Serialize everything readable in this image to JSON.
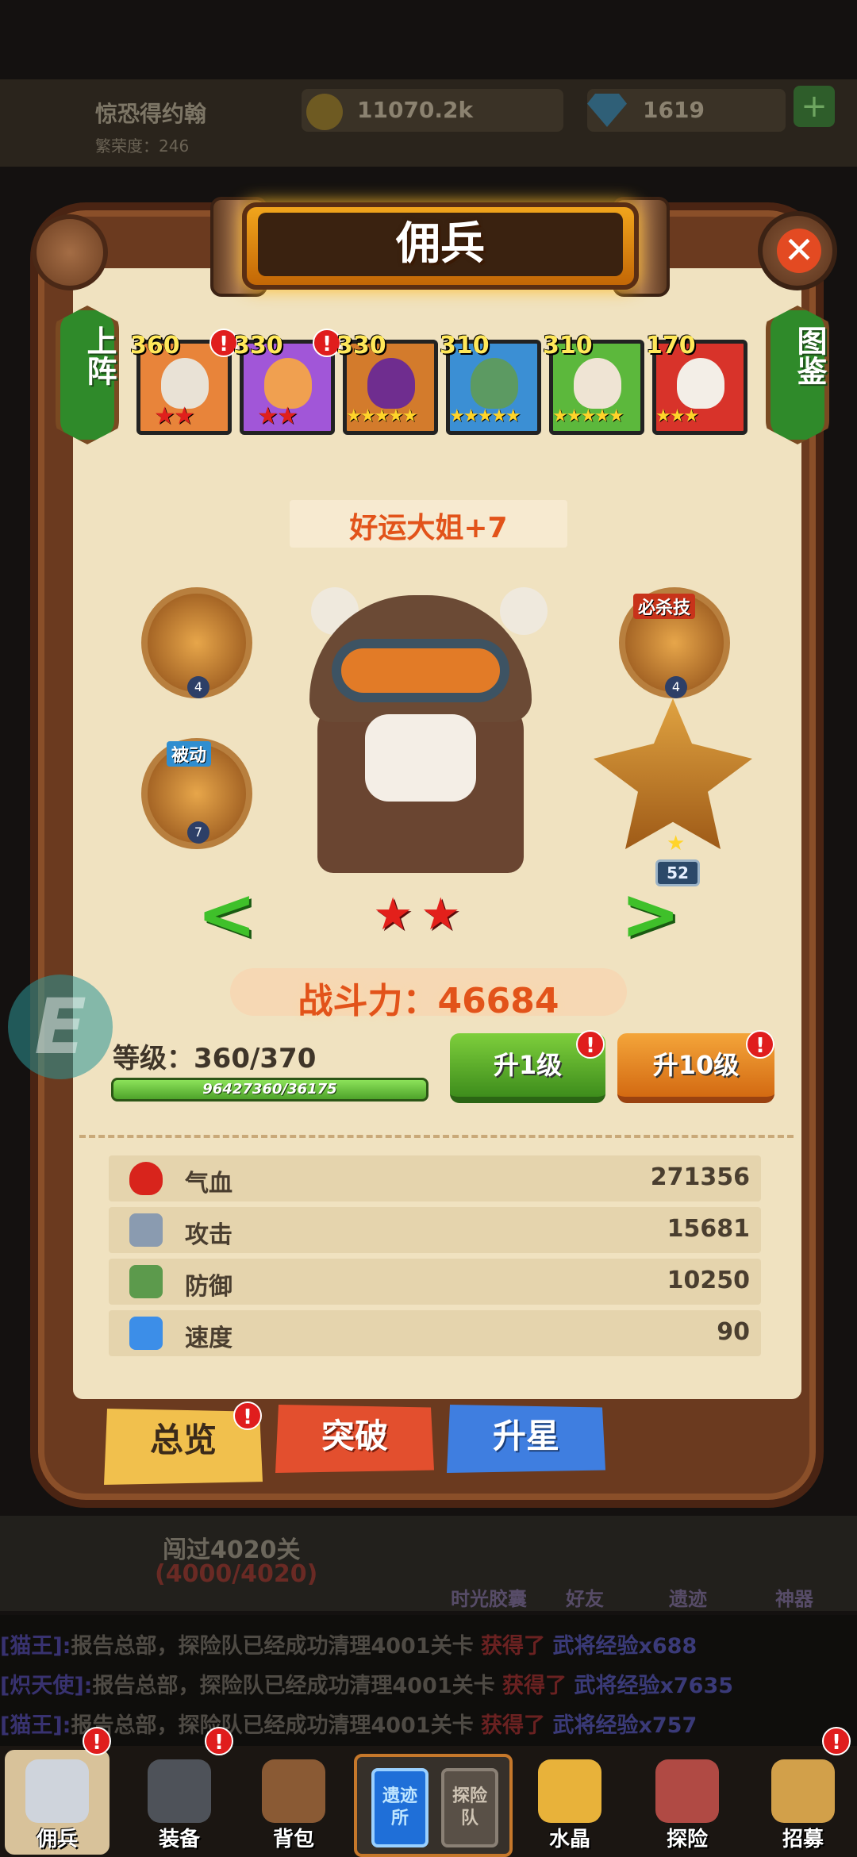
{
  "background": {
    "player_name": "惊恐得约翰",
    "reputation": "繁荣度：246",
    "coins": "11070.2k",
    "gems": "1619",
    "stage_title": "闯过4020关",
    "stage_progress": "(4000/4020)",
    "feature_labels": [
      "时光胶囊",
      "好友",
      "遗迹",
      "神器"
    ],
    "chat": [
      {
        "who": "[猫王]:",
        "msg": "报告总部，探险队已经成功清理4001关卡",
        "got": "获得了",
        "reward": "武将经验x688"
      },
      {
        "who": "[炽天使]:",
        "msg": "报告总部，探险队已经成功清理4001关卡",
        "got": "获得了",
        "reward": "武将经验x7635"
      },
      {
        "who": "[猫王]:",
        "msg": "报告总部，探险队已经成功清理4001关卡",
        "got": "获得了",
        "reward": "武将经验x757"
      }
    ]
  },
  "panel": {
    "title": "佣兵",
    "left_tab": "上阵",
    "right_tab": "图鉴",
    "close_label": "✕"
  },
  "heroes": [
    {
      "level": "360",
      "stars": "★★",
      "star_color": "red",
      "alert": "!",
      "bg": "#e8843a",
      "face": "#e9e2d6"
    },
    {
      "level": "330",
      "stars": "★★",
      "star_color": "red",
      "alert": "!",
      "bg": "#a156d8",
      "face": "#f0a050"
    },
    {
      "level": "330",
      "stars": "★★★★★",
      "star_color": "gold",
      "alert": "",
      "bg": "#d37b2c",
      "face": "#6f2d8f"
    },
    {
      "level": "310",
      "stars": "★★★★★",
      "star_color": "gold",
      "alert": "",
      "bg": "#3b8fd4",
      "face": "#5c9a62"
    },
    {
      "level": "310",
      "stars": "★★★★★",
      "star_color": "gold",
      "alert": "",
      "bg": "#5cb83c",
      "face": "#efe4d4"
    },
    {
      "level": "170",
      "stars": "★★★",
      "star_color": "gold",
      "alert": "",
      "bg": "#d8332a",
      "face": "#f3eee7"
    }
  ],
  "hero": {
    "name": "好运大姐+7",
    "stars": "★★",
    "power_label": "战斗力：",
    "power_value": "46684",
    "level_label": "等级：",
    "level_value": "360/370",
    "xp_text": "96427360/36175",
    "xp_fraction": 1.0
  },
  "skills": [
    {
      "level": "4",
      "tag": ""
    },
    {
      "level": "7",
      "tag": "被动"
    },
    {
      "level": "4",
      "tag": "必杀技"
    }
  ],
  "weapon": {
    "level": "52",
    "star": "★"
  },
  "arrows": {
    "prev": "<",
    "next": ">"
  },
  "buttons": {
    "up1": "升1级",
    "up10": "升10级",
    "alert": "!"
  },
  "stats": [
    {
      "icon": "heart",
      "name": "气血",
      "value": "271356",
      "color": "#d8241c"
    },
    {
      "icon": "sword",
      "name": "攻击",
      "value": "15681",
      "color": "#8a9bb0"
    },
    {
      "icon": "shield",
      "name": "防御",
      "value": "10250",
      "color": "#5c9a4c"
    },
    {
      "icon": "lightning",
      "name": "速度",
      "value": "90",
      "color": "#3c8ee8"
    }
  ],
  "tabs": {
    "overview": "总览",
    "breakthrough": "突破",
    "star_up": "升星"
  },
  "floating": "E",
  "nav": {
    "items": [
      "佣兵",
      "装备",
      "背包",
      "水晶",
      "探险",
      "招募"
    ],
    "center_a": "遗迹所",
    "center_b": "探险队",
    "alert": "!"
  }
}
